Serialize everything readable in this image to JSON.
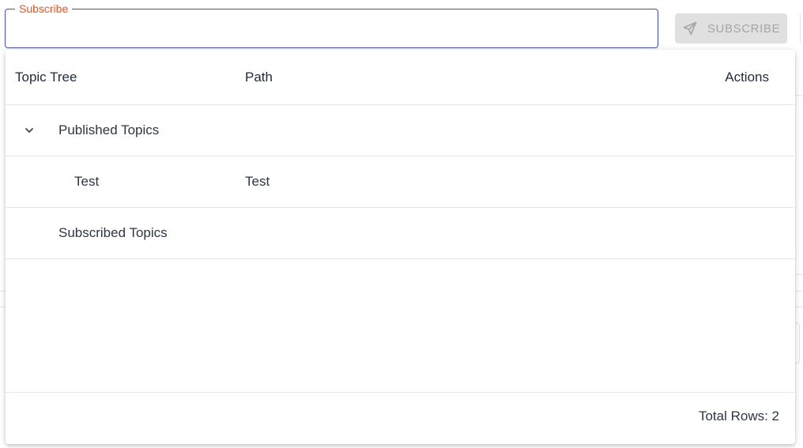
{
  "search": {
    "label": "Subscribe",
    "value": "",
    "placeholder": ""
  },
  "subscribe_button": {
    "label": "SUBSCRIBE",
    "icon": "send-icon",
    "state": "disabled"
  },
  "table": {
    "columns": [
      "Topic Tree",
      "Path",
      "Actions"
    ],
    "rows": [
      {
        "name": "Published Topics",
        "path": "",
        "expandable": true,
        "expanded": true,
        "level": 0
      },
      {
        "name": "Test",
        "path": "Test",
        "expandable": false,
        "level": 1
      },
      {
        "name": "Subscribed Topics",
        "path": "",
        "expandable": false,
        "level": 0
      }
    ],
    "footer": "Total Rows: 2"
  },
  "colors": {
    "accent": "#3f51b5",
    "label": "#f4511e",
    "disabled_bg": "#e0e0e0",
    "disabled_text": "#a6a6a6"
  }
}
